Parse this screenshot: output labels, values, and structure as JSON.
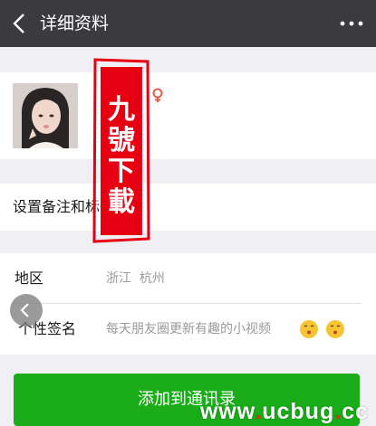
{
  "header": {
    "title": "详细资料"
  },
  "remark": {
    "label": "设置备注和标签"
  },
  "info": {
    "region_label": "地区",
    "region_value": "浙江  杭州",
    "signature_label": "个性签名",
    "signature_value": "每天朋友圈更新有趣的小视频"
  },
  "actions": {
    "add_contact_label": "添加到通讯录"
  },
  "overlay": {
    "seal_lines": [
      "九",
      "號",
      "下",
      "載"
    ],
    "watermark_parts": [
      "www",
      ".",
      "ucbug",
      ".",
      "cc"
    ]
  },
  "icons": {
    "back": "chevron-left",
    "more": "three-dots",
    "gender": "female-symbol",
    "emoji": "kissing-face"
  },
  "colors": {
    "topbar": "#3a3a3f",
    "button": "#1aad19",
    "seal_red": "#e60012",
    "gender": "#e85d48"
  }
}
